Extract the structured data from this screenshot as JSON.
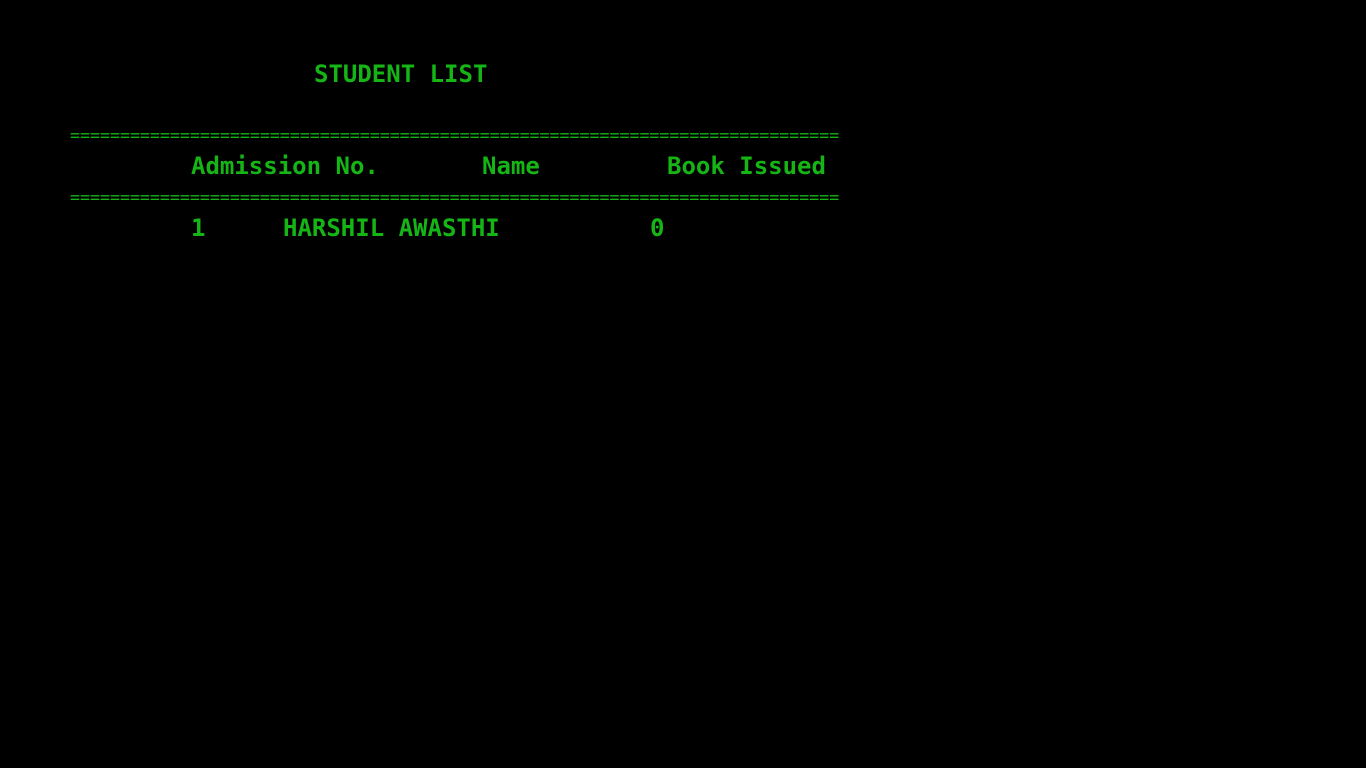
{
  "title": "STUDENT LIST",
  "rule": "=============================================================================",
  "table": {
    "headers": {
      "admission": "Admission No.",
      "name": "Name",
      "book": "Book Issued"
    },
    "rows": [
      {
        "admission": "1",
        "name": "HARSHIL AWASTHI",
        "book": "0"
      }
    ]
  },
  "colors": {
    "text": "#16b516",
    "background": "#000000"
  }
}
